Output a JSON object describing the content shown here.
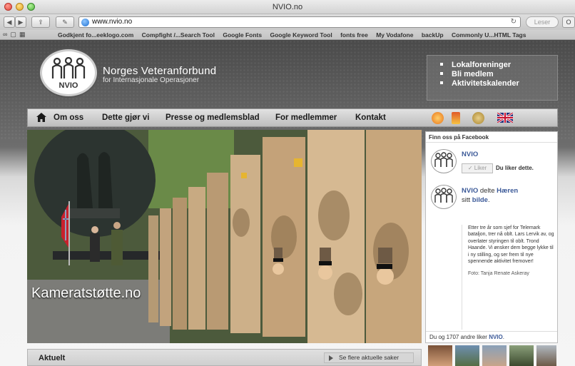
{
  "browser": {
    "window_title": "NVIO.no",
    "url": "www.nvio.no",
    "reader_label": "Leser",
    "bookmarks": [
      "Godkjent fo...eeklogo.com",
      "Compfight /...Search Tool",
      "Google Fonts",
      "Google Keyword Tool",
      "fonts free",
      "My Vodafone",
      "backUp",
      "Commonly U...HTML Tags"
    ]
  },
  "site": {
    "logo_text": "NVIO",
    "org_name": "Norges Veteranforbund",
    "org_sub": "for Internasjonale Operasjoner",
    "quick_links": [
      "Lokalforeninger",
      "Bli medlem",
      "Aktivitetskalender"
    ],
    "nav": {
      "items": [
        "Om oss",
        "Dette gjør vi",
        "Presse og medlemsblad",
        "For medlemmer",
        "Kontakt"
      ],
      "icons": [
        "home-icon",
        "badge-orange-icon",
        "badge-ribbon-icon",
        "badge-un-icon",
        "uk-flag-icon"
      ]
    },
    "hero": {
      "caption": "Kameratstøtte.no"
    },
    "facebook": {
      "header": "Finn oss på Facebook",
      "page_name": "NVIO",
      "like_button": "Liker",
      "liked_text": "Du liker dette.",
      "share_name": "NVIO",
      "share_mid": "delte",
      "share_target": "Hæren",
      "share_sitt": "sitt",
      "share_link": "bilde",
      "post_text": "Etter tre år som sjef for Telemark bataljon, trer nå oblt. Lars Lervik av, og overlater styringen til oblt. Trond Haande. Vi ønsker dem begge lykke til i ny stilling, og ser frem til nye spennende aktivitet fremover!",
      "post_credit": "Foto: Tanja Renate Askeray",
      "footer_prefix": "Du og 1707 andre liker",
      "footer_link": "NVIO"
    },
    "news": {
      "title": "Aktuelt",
      "see_more": "Se flere aktuelle saker"
    }
  }
}
